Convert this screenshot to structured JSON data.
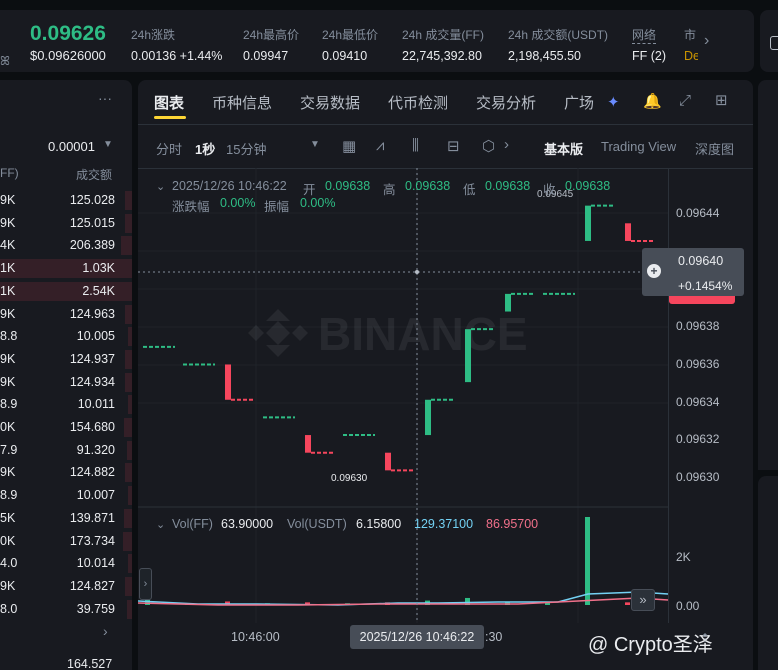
{
  "ticker": {
    "last_price": "0.09626",
    "last_price_usd": "$0.09626000",
    "stats": [
      {
        "label": "24h涨跌",
        "value": "0.00136 +1.44%",
        "value_color": "#2ebd85"
      },
      {
        "label": "24h最高价",
        "value": "0.09947"
      },
      {
        "label": "24h最低价",
        "value": "0.09410"
      },
      {
        "label": "24h 成交量(FF)",
        "value": "22,745,392.80"
      },
      {
        "label": "24h 成交额(USDT)",
        "value": "2,198,455.50"
      },
      {
        "label": "网络",
        "value": "FF (2)"
      },
      {
        "label": "市",
        "value": "De"
      }
    ]
  },
  "orderbook": {
    "more_label": "···",
    "precision": "0.00001",
    "header_left": "FF)",
    "header_right": "成交额",
    "rows": [
      {
        "amount": "9K",
        "total": "125.028",
        "depth": 0.05
      },
      {
        "amount": "9K",
        "total": "125.015",
        "depth": 0.05
      },
      {
        "amount": "4K",
        "total": "206.389",
        "depth": 0.08
      },
      {
        "amount": "1K",
        "total": "1.03K",
        "depth": 1.0
      },
      {
        "amount": "1K",
        "total": "2.54K",
        "depth": 1.0
      },
      {
        "amount": "9K",
        "total": "124.963",
        "depth": 0.05
      },
      {
        "amount": "8.8",
        "total": "10.005",
        "depth": 0.03
      },
      {
        "amount": "9K",
        "total": "124.937",
        "depth": 0.05
      },
      {
        "amount": "9K",
        "total": "124.934",
        "depth": 0.05
      },
      {
        "amount": "8.9",
        "total": "10.011",
        "depth": 0.03
      },
      {
        "amount": "0K",
        "total": "154.680",
        "depth": 0.06
      },
      {
        "amount": "7.9",
        "total": "91.320",
        "depth": 0.04
      },
      {
        "amount": "9K",
        "total": "124.882",
        "depth": 0.05
      },
      {
        "amount": "8.9",
        "total": "10.007",
        "depth": 0.03
      },
      {
        "amount": "5K",
        "total": "139.871",
        "depth": 0.06
      },
      {
        "amount": "0K",
        "total": "173.734",
        "depth": 0.07
      },
      {
        "amount": "4.0",
        "total": "10.014",
        "depth": 0.03
      },
      {
        "amount": "9K",
        "total": "124.827",
        "depth": 0.05
      },
      {
        "amount": "8.0",
        "total": "39.759",
        "depth": 0.04
      }
    ],
    "footer_value": "164.527"
  },
  "chart_panel": {
    "tabs": [
      "图表",
      "币种信息",
      "交易数据",
      "代币检测",
      "交易分析",
      "广场"
    ],
    "intervals": [
      "分时",
      "1秒",
      "15分钟"
    ],
    "active_interval": "1秒",
    "views": [
      "基本版",
      "Trading View",
      "深度图"
    ],
    "active_view": "基本版"
  },
  "ohlc_legend": {
    "datetime": "2025/12/26 10:46:22",
    "open_label": "开",
    "open": "0.09638",
    "high_label": "高",
    "high": "0.09638",
    "low_label": "低",
    "low": "0.09638",
    "close_label": "收",
    "close": "0.09638",
    "change_label": "涨跌幅",
    "change": "0.00%",
    "amplitude_label": "振幅",
    "amplitude": "0.00%"
  },
  "volume_legend": {
    "vol_label": "Vol(FF)",
    "vol_value": "63.90000",
    "vol_usdt_label": "Vol(USDT)",
    "vol_usdt_value": "6.15800",
    "ma1_value": "129.37100",
    "ma2_value": "86.95700"
  },
  "crosshair": {
    "price": "0.09640",
    "pct": "+0.1454%",
    "time": "2025/12/26 10:46:22"
  },
  "x_tick": "10:46:00",
  "x_tick_partial": ":30",
  "watermark": "@ Crypto圣泽",
  "chart_data": {
    "type": "candlestick",
    "y_ticks": [
      "0.09644",
      "0.09638",
      "0.09636",
      "0.09634",
      "0.09632",
      "0.09630"
    ],
    "ylim": [
      0.09629,
      0.09646
    ],
    "high_marker": "0.09645",
    "low_marker": "0.09630",
    "volume_ticks": [
      "2K",
      "0.00"
    ],
    "candles": [
      {
        "o": 0.09637,
        "c": 0.09637,
        "dir": "flat"
      },
      {
        "o": 0.09636,
        "c": 0.09636,
        "dir": "flat"
      },
      {
        "o": 0.09636,
        "c": 0.09634,
        "dir": "down"
      },
      {
        "o": 0.09633,
        "c": 0.09633,
        "dir": "flat"
      },
      {
        "o": 0.09632,
        "c": 0.09631,
        "dir": "down"
      },
      {
        "o": 0.09632,
        "c": 0.09632,
        "dir": "flat"
      },
      {
        "o": 0.09631,
        "c": 0.0963,
        "dir": "down"
      },
      {
        "o": 0.09632,
        "c": 0.09634,
        "dir": "up"
      },
      {
        "o": 0.09635,
        "c": 0.09638,
        "dir": "up"
      },
      {
        "o": 0.09639,
        "c": 0.0964,
        "dir": "up"
      },
      {
        "o": 0.0964,
        "c": 0.0964,
        "dir": "flat"
      },
      {
        "o": 0.09643,
        "c": 0.09645,
        "dir": "up"
      },
      {
        "o": 0.09644,
        "c": 0.09643,
        "dir": "down"
      }
    ]
  }
}
